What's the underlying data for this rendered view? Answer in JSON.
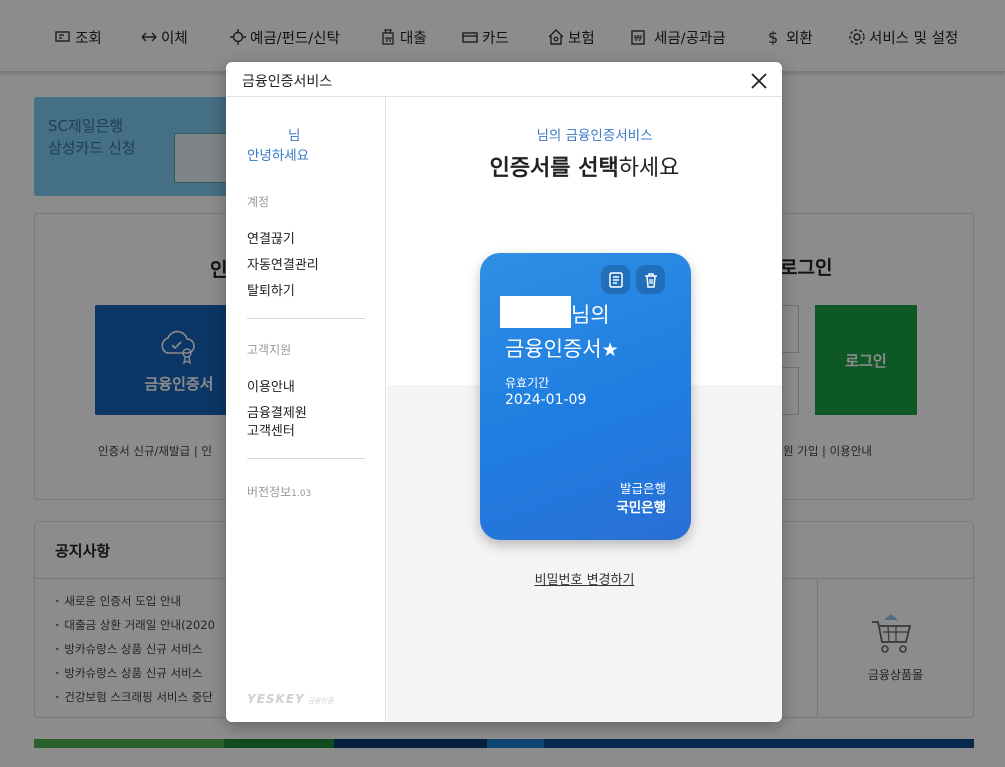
{
  "topnav": {
    "items": [
      {
        "label": "조회",
        "icon": "inquiry-icon"
      },
      {
        "label": "이체",
        "icon": "transfer-icon"
      },
      {
        "label": "예금/펀드/신탁",
        "icon": "deposit-icon"
      },
      {
        "label": "대출",
        "icon": "loan-icon"
      },
      {
        "label": "카드",
        "icon": "card-icon"
      },
      {
        "label": "보험",
        "icon": "insurance-icon"
      },
      {
        "label": "세금/공과금",
        "icon": "tax-icon"
      },
      {
        "label": "외환",
        "icon": "dollar-icon"
      },
      {
        "label": "서비스 및 설정",
        "icon": "gear-icon"
      }
    ]
  },
  "banner": {
    "line1": "SC제일은행",
    "line2": "삼성카드 신청"
  },
  "login_section": {
    "left_title_partial": "인",
    "right_title": "로그인",
    "cert_button_label": "금융인증서",
    "login_button_label": "로그인",
    "links_left": "인증서 신규/재발급 | 인",
    "links_right": "원 가입 | 이용안내"
  },
  "notice": {
    "title": "공지사항",
    "items": [
      "새로운 인증서 도입 안내",
      "대출금 상환 거래일 안내(2020",
      "방카슈랑스 상품 신규 서비스",
      "방카슈랑스 상품 신규 서비스",
      "건강보험 스크래핑 서비스 중단"
    ],
    "mall_label": "금융상품몰"
  },
  "modal": {
    "title": "금융인증서비스",
    "sidebar": {
      "user_suffix": "님",
      "greeting": "안녕하세요",
      "section_account": "계정",
      "account_links": [
        "연결끊기",
        "자동연결관리",
        "탈퇴하기"
      ],
      "section_support": "고객지원",
      "support_links": [
        "이용안내",
        "금융결제원",
        "고객센터"
      ],
      "version_label": "버전정보",
      "version_number": "1.03",
      "brand": "YESKEY",
      "brand_sub": "금융인증"
    },
    "main": {
      "subtitle": "님의 금융인증서비스",
      "heading_bold": "인증서를 선택",
      "heading_rest": "하세요",
      "card": {
        "owner_suffix": "님의",
        "name": "금융인증서",
        "star": "★",
        "validity_label": "유효기간",
        "validity_date": "2024-01-09",
        "issuer_label": "발급은행",
        "issuer": "국민은행"
      },
      "change_password_link": "비밀번호 변경하기"
    }
  },
  "colors": {
    "accent_blue": "#3a78c8",
    "card_blue": "#1f7de0",
    "login_green": "#18a043",
    "cert_button_blue": "#1463b8"
  }
}
